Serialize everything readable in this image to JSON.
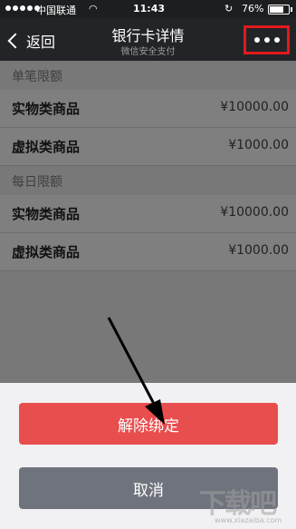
{
  "status_bar": {
    "carrier": "中国联通",
    "time": "11:43",
    "battery_percent": "76%",
    "battery_level": 0.76
  },
  "nav": {
    "back_label": "返回",
    "title": "银行卡详情",
    "subtitle": "微信安全支付"
  },
  "limits": [
    {
      "header": "单笔限额",
      "rows": [
        {
          "name": "实物类商品",
          "value": "¥10000.00"
        },
        {
          "name": "虚拟类商品",
          "value": "¥1000.00"
        }
      ]
    },
    {
      "header": "每日限额",
      "rows": [
        {
          "name": "实物类商品",
          "value": "¥10000.00"
        },
        {
          "name": "虚拟类商品",
          "value": "¥1000.00"
        }
      ]
    }
  ],
  "sheet": {
    "unbind_label": "解除绑定",
    "cancel_label": "取消"
  },
  "colors": {
    "highlight": "#e3191b",
    "unbind_button": "#e84e4e",
    "cancel_button": "#6f737d"
  },
  "watermark": {
    "text": "下载吧",
    "url": "www.xiazaiba.com"
  }
}
